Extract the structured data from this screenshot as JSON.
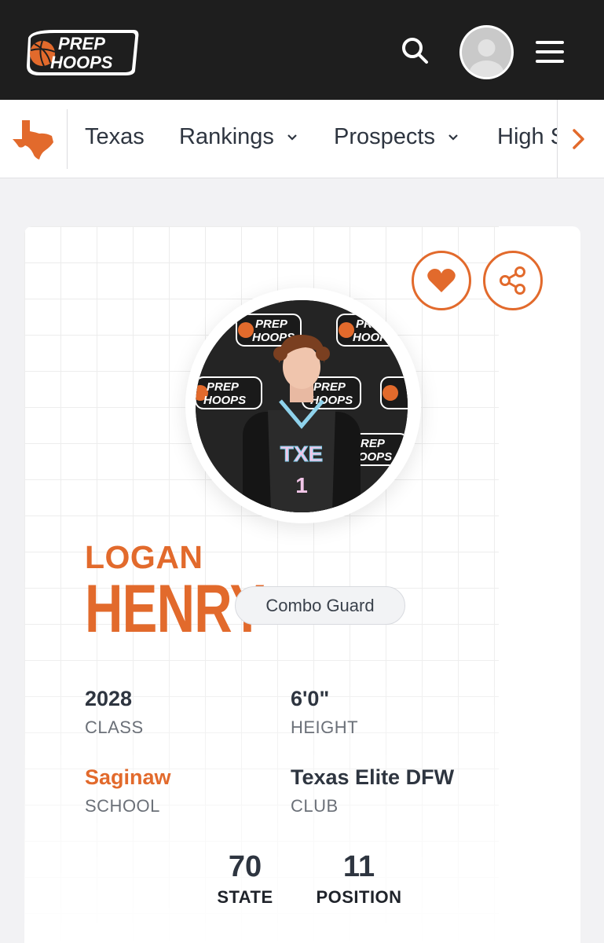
{
  "header": {
    "logo_line1": "PREP",
    "logo_line2": "HOOPS",
    "icons": {
      "search": "search-icon",
      "avatar": "user-avatar",
      "menu": "hamburger-menu-icon"
    }
  },
  "nav": {
    "state_icon": "texas-map-icon",
    "items": [
      {
        "label": "Texas",
        "has_dropdown": false
      },
      {
        "label": "Rankings",
        "has_dropdown": true
      },
      {
        "label": "Prospects",
        "has_dropdown": true
      },
      {
        "label": "High S",
        "has_dropdown": false
      }
    ],
    "scroll_icon": "chevron-right-icon"
  },
  "player": {
    "first_name": "LOGAN",
    "last_name": "HENRY",
    "position": "Combo Guard",
    "photo_backdrop_text": [
      "PREP",
      "HOOPS"
    ],
    "jersey_text": "TXE",
    "jersey_number": "1",
    "stats": {
      "class": {
        "value": "2028",
        "label": "CLASS"
      },
      "height": {
        "value": "6'0\"",
        "label": "HEIGHT"
      },
      "school": {
        "value": "Saginaw",
        "label": "SCHOOL"
      },
      "club": {
        "value": "Texas Elite DFW",
        "label": "CLUB"
      }
    },
    "rankings": {
      "state": {
        "value": "70",
        "label": "STATE"
      },
      "position": {
        "value": "11",
        "label": "POSITION"
      }
    }
  },
  "actions": {
    "favorite_icon": "heart-icon",
    "share_icon": "share-icon"
  },
  "colors": {
    "accent": "#e26a2c",
    "header_bg": "#1e1e1e",
    "text": "#2e3540"
  }
}
